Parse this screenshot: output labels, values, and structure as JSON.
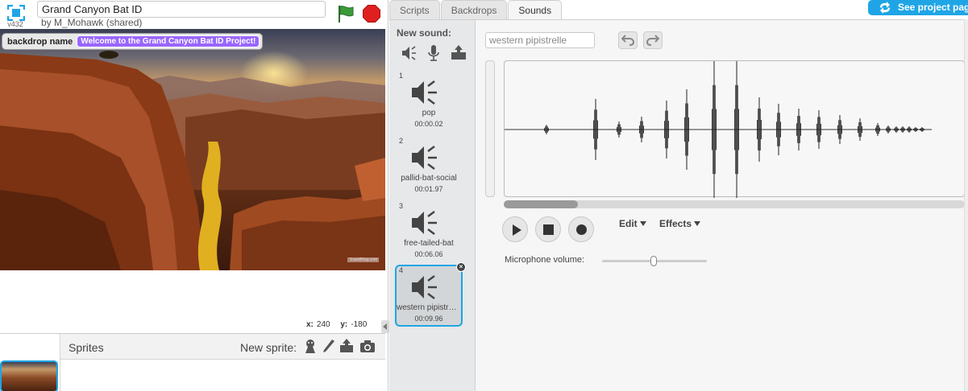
{
  "app": {
    "version": "v432",
    "project_title": "Grand Canyon Bat ID",
    "byline": "by M_Mohawk (shared)"
  },
  "stage": {
    "monitor_name": "backdrop name",
    "monitor_value": "Welcome to the Grand Canyon Bat ID Project!",
    "watermark": "TravelBlog.com",
    "coords": {
      "x_label": "x:",
      "x_value": "240",
      "y_label": "y:",
      "y_value": "-180"
    }
  },
  "sprites": {
    "title": "Sprites",
    "new_sprite_label": "New sprite:",
    "icons": [
      "sprite-library-icon",
      "paint-icon",
      "upload-icon",
      "camera-icon"
    ]
  },
  "tabs": [
    {
      "label": "Scripts",
      "active": false
    },
    {
      "label": "Backdrops",
      "active": false
    },
    {
      "label": "Sounds",
      "active": true
    }
  ],
  "see_project_page": "See project page",
  "sounds": {
    "new_sound_label": "New sound:",
    "new_sound_icons": [
      "sound-library-icon",
      "microphone-icon",
      "upload-icon"
    ],
    "items": [
      {
        "num": "1",
        "name": "pop",
        "duration": "00:00.02"
      },
      {
        "num": "2",
        "name": "pallid-bat-social",
        "duration": "00:01.97"
      },
      {
        "num": "3",
        "name": "free-tailed-bat",
        "duration": "00:06.06"
      },
      {
        "num": "4",
        "name": "western pipistrelle",
        "duration": "00:09.96",
        "selected": true
      }
    ],
    "selected_index": 3
  },
  "editor": {
    "sound_name_value": "western pipistrelle",
    "edit_menu": "Edit",
    "effects_menu": "Effects",
    "mic_label": "Microphone volume:",
    "mic_volume_fraction": 0.49,
    "waveform_scroll_fraction": 0.16
  },
  "colors": {
    "accent": "#1fa5e6",
    "monitor_value_bg": "#9966ff",
    "flag_green": "#3a9a3a",
    "stop_red": "#e02020"
  }
}
